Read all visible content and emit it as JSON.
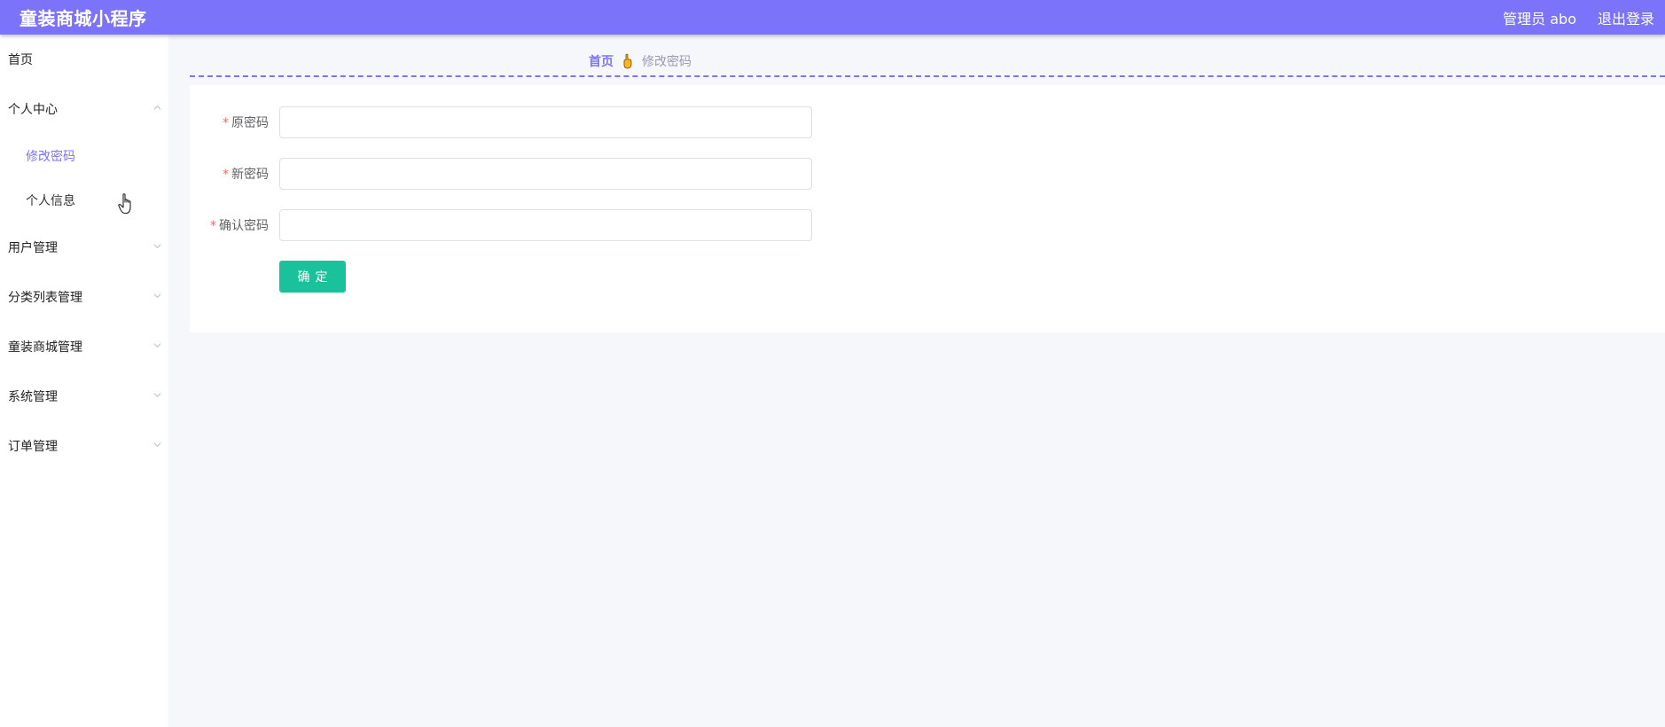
{
  "header": {
    "title": "童装商城小程序",
    "user": "管理员 abo",
    "logout": "退出登录"
  },
  "sidebar": {
    "items": [
      {
        "label": "首页"
      },
      {
        "label": "个人中心",
        "expanded": true,
        "children": [
          {
            "label": "修改密码",
            "active": true
          },
          {
            "label": "个人信息"
          }
        ]
      },
      {
        "label": "用户管理"
      },
      {
        "label": "分类列表管理"
      },
      {
        "label": "童装商城管理"
      },
      {
        "label": "系统管理"
      },
      {
        "label": "订单管理"
      }
    ]
  },
  "breadcrumb": {
    "home": "首页",
    "current": "修改密码"
  },
  "form": {
    "required_mark": "*",
    "fields": [
      {
        "label": "原密码",
        "value": "",
        "placeholder": ""
      },
      {
        "label": "新密码",
        "value": "",
        "placeholder": ""
      },
      {
        "label": "确认密码",
        "value": "",
        "placeholder": ""
      }
    ],
    "submit": "确定"
  },
  "colors": {
    "accent": "#7b73f9",
    "button": "#19c29b",
    "required": "#f56c6c"
  }
}
